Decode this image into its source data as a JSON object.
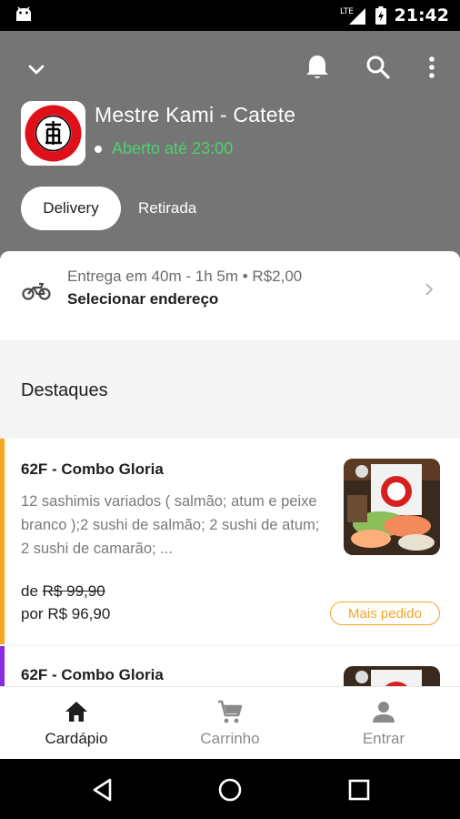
{
  "status_bar": {
    "time": "21:42",
    "network": "LTE"
  },
  "header": {
    "store_name": "Mestre Kami - Catete",
    "open_status": "Aberto até 23:00",
    "tabs": [
      {
        "label": "Delivery",
        "selected": true
      },
      {
        "label": "Retirada",
        "selected": false
      }
    ]
  },
  "delivery": {
    "info": "Entrega em 40m - 1h 5m • R$2,00",
    "action": "Selecionar endereço"
  },
  "section": {
    "title": "Destaques"
  },
  "products": [
    {
      "title": "62F - Combo Gloria",
      "description": "12 sashimis  variados ( salmão; atum e peixe branco );2 sushi de salmão; 2 sushi de atum; 2 sushi de camarão; ...",
      "old_price_prefix": "de",
      "old_price": "R$ 99,90",
      "new_price_prefix": "por",
      "new_price": "R$ 96,90",
      "badge": "Mais pedido",
      "accent_color": "#f5a623"
    },
    {
      "title": "62F - Combo Gloria",
      "accent_color": "#8a2be2"
    }
  ],
  "bottom_nav": [
    {
      "label": "Cardápio",
      "icon": "home-icon",
      "active": true
    },
    {
      "label": "Carrinho",
      "icon": "cart-icon",
      "active": false
    },
    {
      "label": "Entrar",
      "icon": "person-icon",
      "active": false
    }
  ],
  "colors": {
    "header_bg": "#757575",
    "open_green": "#4cd16f",
    "badge_orange": "#f5a623",
    "active_nav": "#1e1e1e",
    "inactive_nav": "#8a8a8a"
  }
}
